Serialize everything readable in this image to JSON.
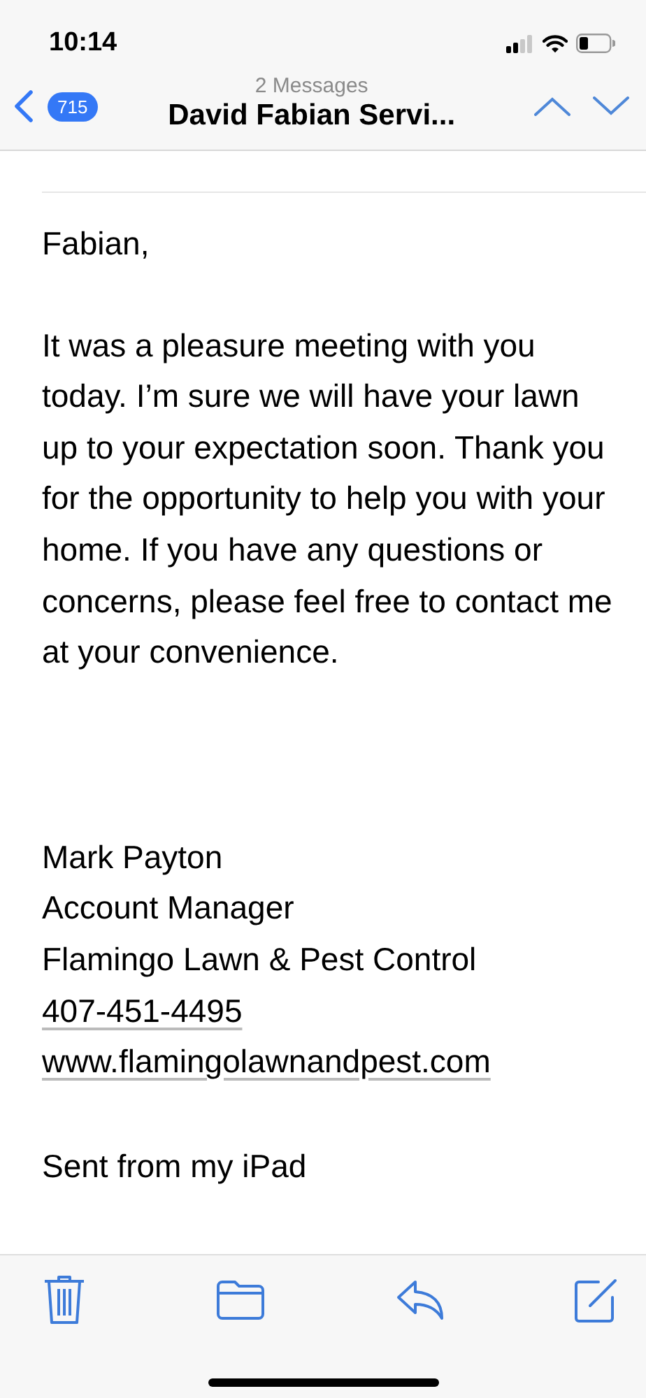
{
  "status_bar": {
    "time": "10:14"
  },
  "nav": {
    "badge": "715",
    "subtitle": "2 Messages",
    "title": "David Fabian Servi..."
  },
  "message": {
    "greeting": "Fabian,",
    "body": "It was a pleasure meeting with you today. I’m sure we will have your lawn up to your expectation soon. Thank you for the opportunity to help you with your home. If you have any questions or concerns, please feel free to contact me at your convenience.",
    "signature": [
      {
        "kind": "text",
        "text": "Mark Payton"
      },
      {
        "kind": "text",
        "text": "Account Manager"
      },
      {
        "kind": "text",
        "text": "Flamingo Lawn & Pest Control"
      },
      {
        "kind": "link",
        "text": "407-451-4495"
      },
      {
        "kind": "link",
        "text": "www.flamingolawnandpest.com"
      }
    ],
    "footer": "Sent from my iPad"
  }
}
